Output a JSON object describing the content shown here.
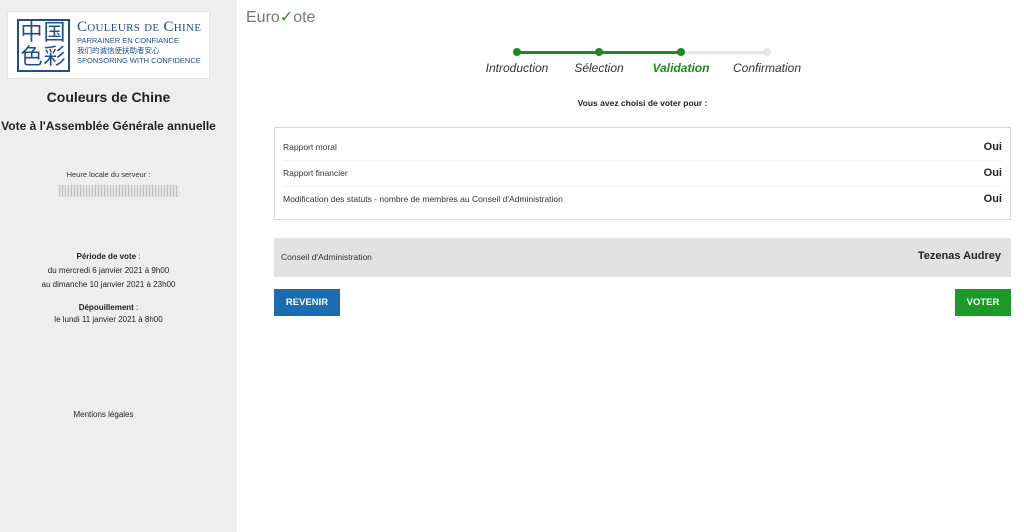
{
  "sidebar": {
    "logo": {
      "chinese_chars": "中国色彩",
      "title": "Couleurs de Chine",
      "tagline_fr": "PARRAINER EN CONFIANCE",
      "tagline_cn": "我们的诚信使扶助者安心",
      "tagline_en": "SPONSORING WITH CONFIDENCE"
    },
    "org_name": "Couleurs de Chine",
    "vote_title": "Vote à l'Assemblée Générale annuelle",
    "clock_label": "Heure locale du serveur :",
    "period_label": "Période de vote",
    "period_sep": " :",
    "period_start": "du mercredi 6 janvier 2021 à 9h00",
    "period_end": "au dimanche 10 janvier 2021 à 23h00",
    "count_label": "Dépouillement",
    "count_sep": " :",
    "count_date": "le lundi 11 janvier 2021 à 8h00",
    "legal_link": "Mentions légales"
  },
  "brand": {
    "prefix": "Euro",
    "check": "✓",
    "suffix": "ote"
  },
  "steps": [
    {
      "label": "Introduction",
      "state": "done"
    },
    {
      "label": "Sélection",
      "state": "done"
    },
    {
      "label": "Validation",
      "state": "active"
    },
    {
      "label": "Confirmation",
      "state": "todo"
    }
  ],
  "main": {
    "chosen_text": "Vous avez choisi de voter pour :",
    "resolutions": [
      {
        "label": "Rapport moral",
        "answer": "Oui"
      },
      {
        "label": "Rapport financier",
        "answer": "Oui"
      },
      {
        "label": "Modification des statuts - nombre de membres au Conseil d'Administration",
        "answer": "Oui"
      }
    ],
    "council": {
      "label": "Conseil d'Administration",
      "candidate": "Tezenas Audrey"
    },
    "back_button": "Revenir",
    "vote_button": "Voter"
  },
  "colors": {
    "accent_green": "#1b8a24",
    "button_blue": "#1c6cb0",
    "button_green": "#1b9a2a",
    "sidebar_bg": "#eeeeee"
  }
}
